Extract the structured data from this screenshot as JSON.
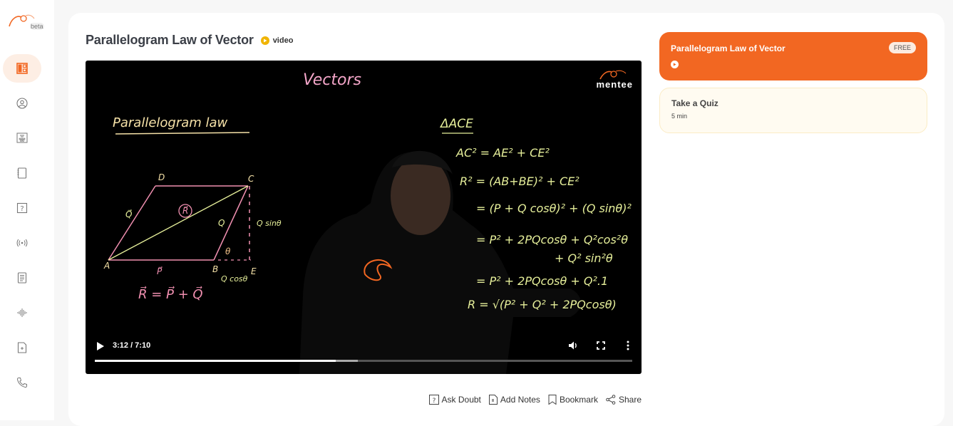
{
  "app": {
    "brand_badge": "beta"
  },
  "sidebar": {
    "items": [
      {
        "name": "dashboard",
        "icon": "dashboard-icon",
        "active": true
      },
      {
        "name": "profile",
        "icon": "user-circle-icon",
        "active": false
      },
      {
        "name": "classroom",
        "icon": "classroom-icon",
        "active": false
      },
      {
        "name": "notebook",
        "icon": "notebook-icon",
        "active": false
      },
      {
        "name": "doubts",
        "icon": "question-icon",
        "active": false
      },
      {
        "name": "live",
        "icon": "broadcast-icon",
        "active": false
      },
      {
        "name": "notes",
        "icon": "document-icon",
        "active": false
      },
      {
        "name": "audio",
        "icon": "audio-wave-icon",
        "active": false
      },
      {
        "name": "add-file",
        "icon": "file-plus-icon",
        "active": false
      },
      {
        "name": "contact",
        "icon": "phone-icon",
        "active": false
      }
    ]
  },
  "lesson": {
    "title": "Parallelogram Law of Vector",
    "type_label": "video"
  },
  "video": {
    "brand": "mentee",
    "current_time": "3:12",
    "duration": "7:10",
    "time_display": "3:12 / 7:10",
    "played_fraction": 0.448,
    "buffered_fraction": 0.49,
    "board": {
      "heading": "Vectors",
      "left_title": "Parallelogram law",
      "vertex_labels": [
        "D",
        "C",
        "A",
        "B",
        "E"
      ],
      "vector_labels": [
        "Q⃗",
        "R⃗",
        "P⃗",
        "Q",
        "θ"
      ],
      "side_labels": [
        "Q sinθ",
        "Q cosθ"
      ],
      "formula_left": "R⃗ = P⃗ + Q⃗",
      "triangle_label": "ΔACE",
      "derivation": [
        "AC² = AE² + CE²",
        "R² = (AB+BE)² + CE²",
        "= (P + Q cosθ)² + (Q sinθ)²",
        "= P² + 2PQcosθ + Q²cos²θ",
        "+ Q² sin²θ",
        "= P² + 2PQcosθ + Q².1",
        "R = √(P² + Q² + 2PQcosθ)"
      ]
    }
  },
  "actions": {
    "ask_doubt": "Ask Doubt",
    "add_notes": "Add Notes",
    "bookmark": "Bookmark",
    "share": "Share"
  },
  "playlist": {
    "items": [
      {
        "title": "Parallelogram Law of Vector",
        "badge": "FREE",
        "icon": "play-circle-icon",
        "active": true
      },
      {
        "title": "Take a Quiz",
        "meta": "5 min",
        "active": false
      }
    ]
  },
  "colors": {
    "accent": "#f26722",
    "active_nav_bg": "#fdeee4",
    "video_badge": "#f0b400",
    "quiz_bg": "#fffbf1"
  }
}
